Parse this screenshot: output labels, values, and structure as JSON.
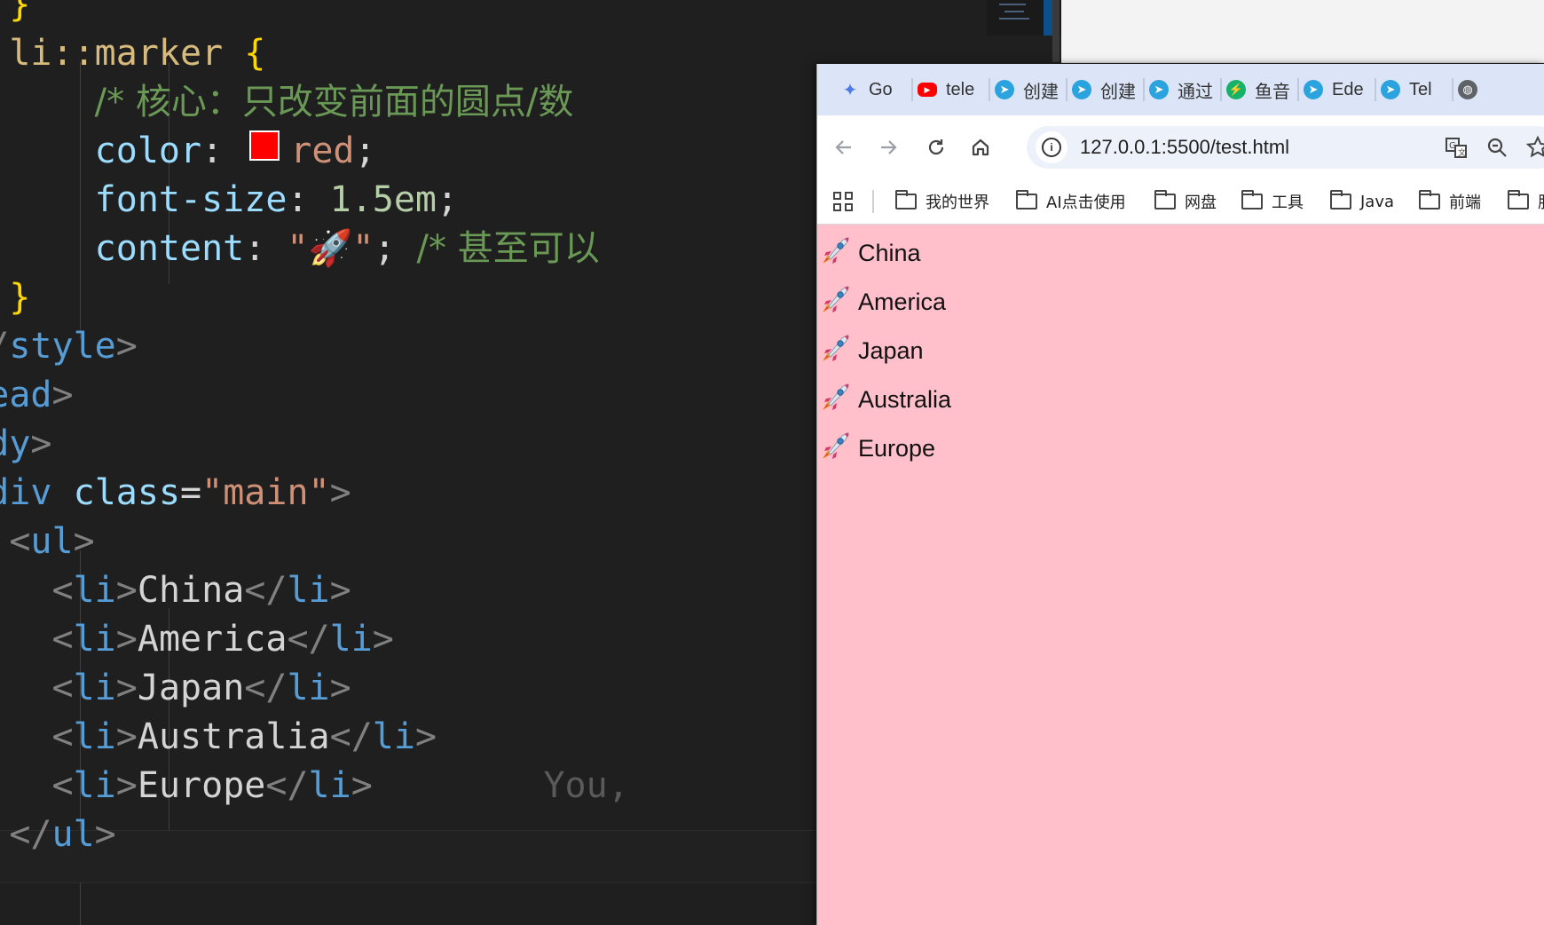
{
  "editor": {
    "lines": [
      [
        {
          "t": "    ",
          "c": "plain"
        },
        {
          "t": "}",
          "c": "brace"
        }
      ],
      [
        {
          "t": "    li::marker ",
          "c": "kw-sel"
        },
        {
          "t": "{",
          "c": "brace"
        }
      ],
      [
        {
          "t": "        ",
          "c": "plain"
        },
        {
          "t": "/* 核心：只改变前面的圆点/数",
          "c": "cmt"
        }
      ],
      [
        {
          "t": "        ",
          "c": "plain"
        },
        {
          "t": "color",
          "c": "prop"
        },
        {
          "t": ": ",
          "c": "plain"
        },
        {
          "t": "SWATCH",
          "c": "swatch"
        },
        {
          "t": "red",
          "c": "str"
        },
        {
          "t": ";",
          "c": "plain"
        }
      ],
      [
        {
          "t": "        ",
          "c": "plain"
        },
        {
          "t": "font-size",
          "c": "prop"
        },
        {
          "t": ": ",
          "c": "plain"
        },
        {
          "t": "1.5em",
          "c": "num"
        },
        {
          "t": ";",
          "c": "plain"
        }
      ],
      [
        {
          "t": "        ",
          "c": "plain"
        },
        {
          "t": "content",
          "c": "prop"
        },
        {
          "t": ": ",
          "c": "plain"
        },
        {
          "t": "\"🚀\"",
          "c": "str"
        },
        {
          "t": "; ",
          "c": "plain"
        },
        {
          "t": "/* 甚至可以",
          "c": "cmt"
        }
      ],
      [
        {
          "t": "    ",
          "c": "plain"
        },
        {
          "t": "}",
          "c": "brace"
        }
      ],
      [
        {
          "t": "  ",
          "c": "plain"
        },
        {
          "t": "</",
          "c": "bracket"
        },
        {
          "t": "style",
          "c": "tag"
        },
        {
          "t": ">",
          "c": "bracket"
        }
      ],
      [
        {
          "t": "</",
          "c": "bracket"
        },
        {
          "t": "head",
          "c": "tag"
        },
        {
          "t": ">",
          "c": "bracket"
        }
      ],
      [
        {
          "t": "<",
          "c": "bracket"
        },
        {
          "t": "body",
          "c": "tag"
        },
        {
          "t": ">",
          "c": "bracket"
        }
      ],
      [
        {
          "t": "  ",
          "c": "plain"
        },
        {
          "t": "<",
          "c": "bracket"
        },
        {
          "t": "div",
          "c": "tag"
        },
        {
          "t": " ",
          "c": "plain"
        },
        {
          "t": "class",
          "c": "attr"
        },
        {
          "t": "=",
          "c": "plain"
        },
        {
          "t": "\"main\"",
          "c": "str"
        },
        {
          "t": ">",
          "c": "bracket"
        }
      ],
      [
        {
          "t": "    ",
          "c": "plain"
        },
        {
          "t": "<",
          "c": "bracket"
        },
        {
          "t": "ul",
          "c": "tag"
        },
        {
          "t": ">",
          "c": "bracket"
        }
      ],
      [
        {
          "t": "      ",
          "c": "plain"
        },
        {
          "t": "<",
          "c": "bracket"
        },
        {
          "t": "li",
          "c": "tag"
        },
        {
          "t": ">",
          "c": "bracket"
        },
        {
          "t": "China",
          "c": "plain"
        },
        {
          "t": "</",
          "c": "bracket"
        },
        {
          "t": "li",
          "c": "tag"
        },
        {
          "t": ">",
          "c": "bracket"
        }
      ],
      [
        {
          "t": "      ",
          "c": "plain"
        },
        {
          "t": "<",
          "c": "bracket"
        },
        {
          "t": "li",
          "c": "tag"
        },
        {
          "t": ">",
          "c": "bracket"
        },
        {
          "t": "America",
          "c": "plain"
        },
        {
          "t": "</",
          "c": "bracket"
        },
        {
          "t": "li",
          "c": "tag"
        },
        {
          "t": ">",
          "c": "bracket"
        }
      ],
      [
        {
          "t": "      ",
          "c": "plain"
        },
        {
          "t": "<",
          "c": "bracket"
        },
        {
          "t": "li",
          "c": "tag"
        },
        {
          "t": ">",
          "c": "bracket"
        },
        {
          "t": "Japan",
          "c": "plain"
        },
        {
          "t": "</",
          "c": "bracket"
        },
        {
          "t": "li",
          "c": "tag"
        },
        {
          "t": ">",
          "c": "bracket"
        }
      ],
      [
        {
          "t": "      ",
          "c": "plain"
        },
        {
          "t": "<",
          "c": "bracket"
        },
        {
          "t": "li",
          "c": "tag"
        },
        {
          "t": ">",
          "c": "bracket"
        },
        {
          "t": "Australia",
          "c": "plain"
        },
        {
          "t": "</",
          "c": "bracket"
        },
        {
          "t": "li",
          "c": "tag"
        },
        {
          "t": ">",
          "c": "bracket"
        }
      ],
      [
        {
          "t": "      ",
          "c": "plain"
        },
        {
          "t": "<",
          "c": "bracket"
        },
        {
          "t": "li",
          "c": "tag"
        },
        {
          "t": ">",
          "c": "bracket"
        },
        {
          "t": "Europe",
          "c": "plain"
        },
        {
          "t": "</",
          "c": "bracket"
        },
        {
          "t": "li",
          "c": "tag"
        },
        {
          "t": ">",
          "c": "bracket"
        },
        {
          "t": "        You,",
          "c": "ghost"
        }
      ],
      [
        {
          "t": "    ",
          "c": "plain"
        },
        {
          "t": "</",
          "c": "bracket"
        },
        {
          "t": "ul",
          "c": "tag"
        },
        {
          "t": ">",
          "c": "bracket"
        }
      ]
    ]
  },
  "browser": {
    "tabs": [
      {
        "label": "Go",
        "icon": "gemini-icon",
        "color": "#4e7ae8"
      },
      {
        "label": "tele",
        "icon": "youtube-icon",
        "color": "#ff0000"
      },
      {
        "label": "创建",
        "icon": "telegram-icon",
        "color": "#2aa3df"
      },
      {
        "label": "创建",
        "icon": "telegram-icon",
        "color": "#2aa3df"
      },
      {
        "label": "通过",
        "icon": "telegram-icon",
        "color": "#2aa3df"
      },
      {
        "label": "鱼音",
        "icon": "bolt-icon",
        "color": "#17b26a"
      },
      {
        "label": "Ede",
        "icon": "telegram-icon",
        "color": "#2aa3df"
      },
      {
        "label": "Tel",
        "icon": "telegram-icon",
        "color": "#2aa3df"
      },
      {
        "label": "",
        "icon": "globe-icon",
        "color": "#5f6368"
      }
    ],
    "url": "127.0.0.1:5500/test.html",
    "bookmarks": [
      "我的世界",
      "AI点击使用",
      "网盘",
      "工具",
      "Java",
      "前端",
      "服"
    ],
    "list_items": [
      "China",
      "America",
      "Japan",
      "Australia",
      "Europe"
    ]
  }
}
